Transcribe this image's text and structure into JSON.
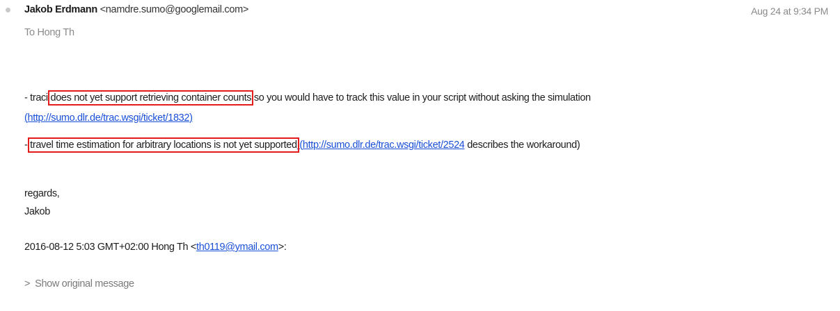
{
  "header": {
    "sender_name": "Jakob Erdmann",
    "sender_email": "<namdre.sumo@googlemail.com>",
    "date": "Aug 24 at 9:34 PM",
    "to_label": "To",
    "to_name": "Hong Th"
  },
  "body": {
    "line1": {
      "prefix": "- traci ",
      "highlight": "does not yet support retrieving container counts",
      "suffix": " so you would have to track this value in your script without asking the simulation"
    },
    "line2": {
      "open_paren": "(",
      "link": "http://sumo.dlr.de/trac.wsgi/ticket/1832",
      "close_paren": ")"
    },
    "line3": {
      "prefix": "- ",
      "highlight": "travel time estimation for arbitrary locations is not yet supported",
      "open_paren": " (",
      "link": "http://sumo.dlr.de/trac.wsgi/ticket/2524",
      "suffix": " describes the workaround)"
    },
    "regards": "regards,",
    "signature": "Jakob",
    "quote_header": {
      "prefix": "2016-08-12 5:03 GMT+02:00 Hong Th <",
      "link": "th0119@ymail.com",
      "suffix": ">:"
    },
    "show_original": "Show original message",
    "chevron": ">"
  },
  "colors": {
    "link": "#1a4fd8",
    "highlight_box": "#e41b1b",
    "muted_text": "#8a8a8a"
  },
  "icons": {
    "status_dot": "unread-dot-icon",
    "expand": "chevron-right-icon"
  }
}
